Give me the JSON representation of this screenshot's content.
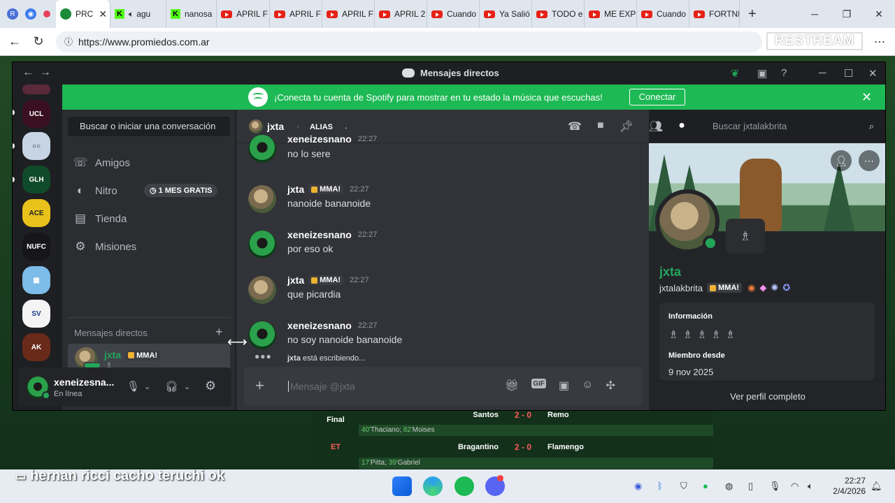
{
  "browser": {
    "tabs": [
      {
        "label": "PRC",
        "kind": "soccer",
        "active": true
      },
      {
        "label": "agu",
        "kind": "kick"
      },
      {
        "label": "nanosa",
        "kind": "kick"
      },
      {
        "label": "APRIL F",
        "kind": "yt"
      },
      {
        "label": "APRIL F",
        "kind": "yt"
      },
      {
        "label": "APRIL F",
        "kind": "yt"
      },
      {
        "label": "APRIL 2",
        "kind": "yt"
      },
      {
        "label": "Cuando",
        "kind": "yt"
      },
      {
        "label": "Ya Salió",
        "kind": "yt"
      },
      {
        "label": "TODO e",
        "kind": "yt"
      },
      {
        "label": "ME EXP",
        "kind": "yt"
      },
      {
        "label": "Cuando",
        "kind": "yt"
      },
      {
        "label": "FORTNI",
        "kind": "yt"
      }
    ],
    "url": "https://www.promiedos.com.ar",
    "watermark": "RESTREAM"
  },
  "discord": {
    "title": "Mensajes directos",
    "banner": {
      "text": "¡Conecta tu cuenta de Spotify para mostrar en tu estado la música que escuchas!",
      "button": "Conectar"
    },
    "search_placeholder": "Buscar o iniciar una conversación",
    "nav": {
      "friends": "Amigos",
      "nitro": "Nitro",
      "nitro_badge": "1 MES GRATIS",
      "shop": "Tienda",
      "missions": "Misiones"
    },
    "dm_header": "Mensajes directos",
    "dm_user": {
      "name": "jxta",
      "tag": "MMA!"
    },
    "current_user": {
      "name": "xeneizesna...",
      "status": "En línea"
    },
    "chat": {
      "name": "jxta",
      "alias": "ALIAS",
      "search": "Buscar jxtalakbrita",
      "typing_user": "jxta",
      "typing_text": "está escribiendo...",
      "placeholder": "Mensaje @jxta",
      "messages": [
        {
          "author": "xeneizesnano",
          "time": "22:27",
          "text": "no lo sere",
          "avatar": "green"
        },
        {
          "author": "jxta",
          "tag": "MMA!",
          "time": "22:27",
          "text": "nanoide bananoide",
          "avatar": "bear"
        },
        {
          "author": "xeneizesnano",
          "time": "22:27",
          "text": "por eso ok",
          "avatar": "green"
        },
        {
          "author": "jxta",
          "tag": "MMA!",
          "time": "22:27",
          "text": "que picardia",
          "avatar": "bear"
        },
        {
          "author": "xeneizesnano",
          "time": "22:27",
          "text": "no soy nanoide bananoide",
          "avatar": "green"
        }
      ]
    },
    "profile": {
      "name": "jxta",
      "handle": "jxtalakbrita",
      "tag": "MMA!",
      "info_label": "Información",
      "member_since_label": "Miembro desde",
      "member_since": "9 nov 2025",
      "view_full": "Ver perfil completo"
    }
  },
  "scores": {
    "rows": [
      {
        "status": "Final",
        "home": "Santos",
        "score": "2 - 0",
        "away": "Remo",
        "scorers_min": "40'",
        "scorers": "Thaciano; ",
        "scorers_min2": "82'",
        "scorers2": "Moises"
      },
      {
        "status": "ET",
        "home": "Bragantino",
        "score": "2 - 0",
        "away": "Flamengo",
        "scorers_min": "17'",
        "scorers": "Pitta; ",
        "scorers_min2": "39'",
        "scorers2": "Gabriel"
      }
    ]
  },
  "overlay_caption": "hernan ricci cacho teruchi ok",
  "taskbar": {
    "time": "22:27",
    "date": "2/4/2026"
  }
}
